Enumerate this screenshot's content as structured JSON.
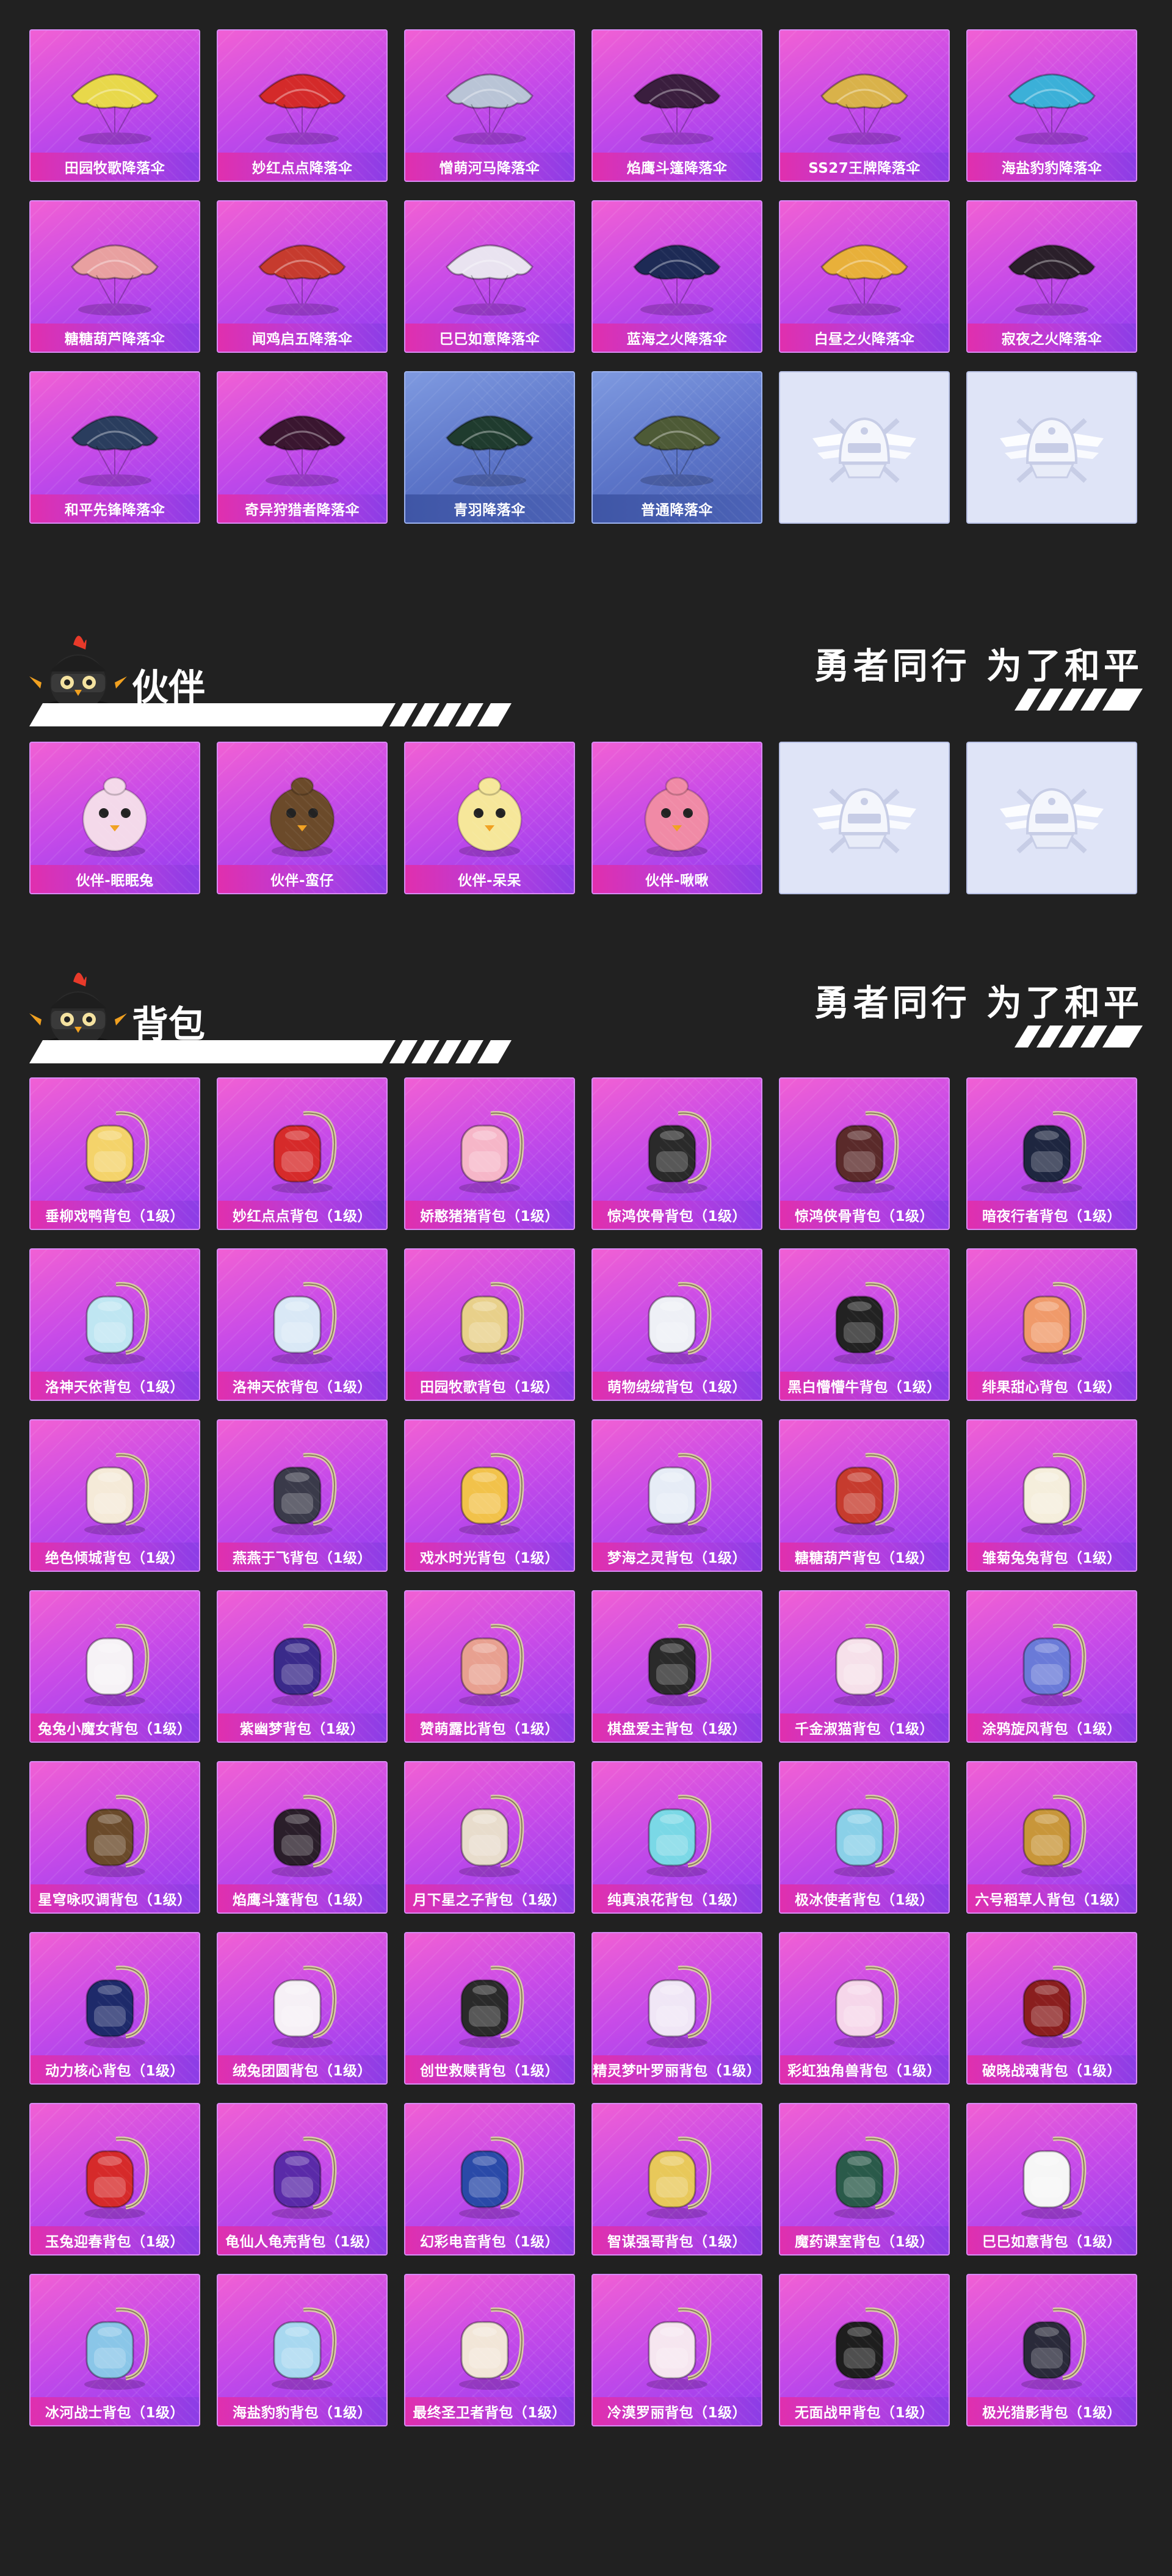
{
  "parachutes": [
    {
      "label": "田园牧歌降落伞",
      "tile": "purple",
      "icon": "parachute-icon",
      "color": "#e8d84a"
    },
    {
      "label": "妙红点点降落伞",
      "tile": "purple",
      "icon": "parachute-icon",
      "color": "#d42a2a"
    },
    {
      "label": "憎萌河马降落伞",
      "tile": "purple",
      "icon": "parachute-icon",
      "color": "#b9c4d6"
    },
    {
      "label": "焰鹰斗篷降落伞",
      "tile": "purple",
      "icon": "parachute-icon",
      "color": "#3a1e3e"
    },
    {
      "label": "SS27王牌降落伞",
      "tile": "purple",
      "icon": "parachute-icon",
      "color": "#d9b24a"
    },
    {
      "label": "海盐豹豹降落伞",
      "tile": "purple",
      "icon": "parachute-icon",
      "color": "#3bb0d8"
    },
    {
      "label": "糖糖葫芦降落伞",
      "tile": "purple",
      "icon": "parachute-icon",
      "color": "#e8a0a0"
    },
    {
      "label": "闻鸡启五降落伞",
      "tile": "purple",
      "icon": "parachute-icon",
      "color": "#c63b2e"
    },
    {
      "label": "巳巳如意降落伞",
      "tile": "purple",
      "icon": "parachute-icon",
      "color": "#e9e3f0"
    },
    {
      "label": "蓝海之火降落伞",
      "tile": "purple",
      "icon": "parachute-icon",
      "color": "#1d2a55"
    },
    {
      "label": "白昼之火降落伞",
      "tile": "purple",
      "icon": "parachute-icon",
      "color": "#e8b03a"
    },
    {
      "label": "寂夜之火降落伞",
      "tile": "purple",
      "icon": "parachute-icon",
      "color": "#2a1f2a"
    },
    {
      "label": "和平先锋降落伞",
      "tile": "purple",
      "icon": "parachute-icon",
      "color": "#2a3d5e"
    },
    {
      "label": "奇异狩猎者降落伞",
      "tile": "purple",
      "icon": "parachute-icon",
      "color": "#3a1630"
    },
    {
      "label": "青羽降落伞",
      "tile": "blue",
      "icon": "parachute-icon",
      "color": "#1f3b2e"
    },
    {
      "label": "普通降落伞",
      "tile": "blue",
      "icon": "parachute-icon",
      "color": "#4d5a36"
    },
    {
      "label": "",
      "tile": "placeholder",
      "icon": "helmet-crest-icon",
      "color": "#ffffff"
    },
    {
      "label": "",
      "tile": "placeholder",
      "icon": "helmet-crest-icon",
      "color": "#ffffff"
    }
  ],
  "companion_section": {
    "title": "伙伴",
    "slogan": "勇者同行 为了和平",
    "items": [
      {
        "label": "伙伴-眠眠兔",
        "tile": "purple",
        "icon": "companion-icon",
        "color": "#f4d9ea"
      },
      {
        "label": "伙伴-蛮仔",
        "tile": "purple",
        "icon": "companion-icon",
        "color": "#6b4a2a"
      },
      {
        "label": "伙伴-呆呆",
        "tile": "purple",
        "icon": "companion-icon",
        "color": "#f6e79a"
      },
      {
        "label": "伙伴-啾啾",
        "tile": "purple",
        "icon": "companion-icon",
        "color": "#f08aa6"
      },
      {
        "label": "",
        "tile": "placeholder",
        "icon": "helmet-crest-icon",
        "color": "#ffffff"
      },
      {
        "label": "",
        "tile": "placeholder",
        "icon": "helmet-crest-icon",
        "color": "#ffffff"
      }
    ]
  },
  "backpack_section": {
    "title": "背包",
    "slogan": "勇者同行 为了和平",
    "items": [
      {
        "label": "垂柳戏鸭背包（1级）",
        "color": "#f4d36a"
      },
      {
        "label": "妙红点点背包（1级）",
        "color": "#d62a2a"
      },
      {
        "label": "娇憨猪猪背包（1级）",
        "color": "#f6b6c8"
      },
      {
        "label": "惊鸿侠骨背包（1级）",
        "color": "#2a2a2a"
      },
      {
        "label": "惊鸿侠骨背包（1级）",
        "color": "#5a2a2a"
      },
      {
        "label": "暗夜行者背包（1级）",
        "color": "#1e2640"
      },
      {
        "label": "洛神天依背包（1级）",
        "color": "#bfe6f2"
      },
      {
        "label": "洛神天依背包（1级）",
        "color": "#d9e8f6"
      },
      {
        "label": "田园牧歌背包（1级）",
        "color": "#e8d08a"
      },
      {
        "label": "萌物绒绒背包（1级）",
        "color": "#eef0f6"
      },
      {
        "label": "黑白懵懵牛背包（1级）",
        "color": "#222222"
      },
      {
        "label": "绯果甜心背包（1级）",
        "color": "#f09a6a"
      },
      {
        "label": "绝色倾城背包（1级）",
        "color": "#f5ead8"
      },
      {
        "label": "燕燕于飞背包（1级）",
        "color": "#3a3a4a"
      },
      {
        "label": "戏水时光背包（1级）",
        "color": "#f2c24a"
      },
      {
        "label": "梦海之灵背包（1级）",
        "color": "#e6ecf6"
      },
      {
        "label": "糖糖葫芦背包（1级）",
        "color": "#c63b2e"
      },
      {
        "label": "雏菊兔兔背包（1级）",
        "color": "#f5eedc"
      },
      {
        "label": "兔兔小魔女背包（1级）",
        "color": "#f6f2f6"
      },
      {
        "label": "紫幽梦背包（1级）",
        "color": "#3a2a8a"
      },
      {
        "label": "赞萌露比背包（1级）",
        "color": "#e8a090"
      },
      {
        "label": "棋盘爱主背包（1级）",
        "color": "#2a2a2a"
      },
      {
        "label": "千金淑猫背包（1级）",
        "color": "#f6e0ea"
      },
      {
        "label": "涂鸦旋风背包（1级）",
        "color": "#6a7ad8"
      },
      {
        "label": "星穹咏叹调背包（1级）",
        "color": "#6a4a2a"
      },
      {
        "label": "焰鹰斗篷背包（1级）",
        "color": "#2a1e2a"
      },
      {
        "label": "月下星之子背包（1级）",
        "color": "#e8dccc"
      },
      {
        "label": "纯真浪花背包（1级）",
        "color": "#7ad8e6"
      },
      {
        "label": "极冰使者背包（1级）",
        "color": "#8ad0e8"
      },
      {
        "label": "六号稻草人背包（1级）",
        "color": "#c8963a"
      },
      {
        "label": "动力核心背包（1级）",
        "color": "#1e2a6a"
      },
      {
        "label": "绒兔团圆背包（1级）",
        "color": "#f6f0f6"
      },
      {
        "label": "创世救赎背包（1级）",
        "color": "#2a2a2a"
      },
      {
        "label": "精灵梦叶罗丽背包（1级）",
        "color": "#f0e6f6"
      },
      {
        "label": "彩虹独角兽背包（1级）",
        "color": "#f6d6ea"
      },
      {
        "label": "破晓战魂背包（1级）",
        "color": "#8a1e1e"
      },
      {
        "label": "玉兔迎春背包（1级）",
        "color": "#d62a2a"
      },
      {
        "label": "龟仙人龟壳背包（1级）",
        "color": "#5a2aa8"
      },
      {
        "label": "幻彩电音背包（1级）",
        "color": "#2a4aa8"
      },
      {
        "label": "智谋强哥背包（1级）",
        "color": "#e8c85a"
      },
      {
        "label": "魔药课室背包（1级）",
        "color": "#2a5a4a"
      },
      {
        "label": "巳巳如意背包（1级）",
        "color": "#f6f6f6"
      },
      {
        "label": "冰河战士背包（1级）",
        "color": "#8ac6e8"
      },
      {
        "label": "海盐豹豹背包（1级）",
        "color": "#a8d8f0"
      },
      {
        "label": "最终圣卫者背包（1级）",
        "color": "#f2e6d8"
      },
      {
        "label": "冷漠罗丽背包（1级）",
        "color": "#f6e6f0"
      },
      {
        "label": "无面战甲背包（1级）",
        "color": "#1e1e1e"
      },
      {
        "label": "极光猎影背包（1级）",
        "color": "#2a2a3a"
      }
    ]
  }
}
